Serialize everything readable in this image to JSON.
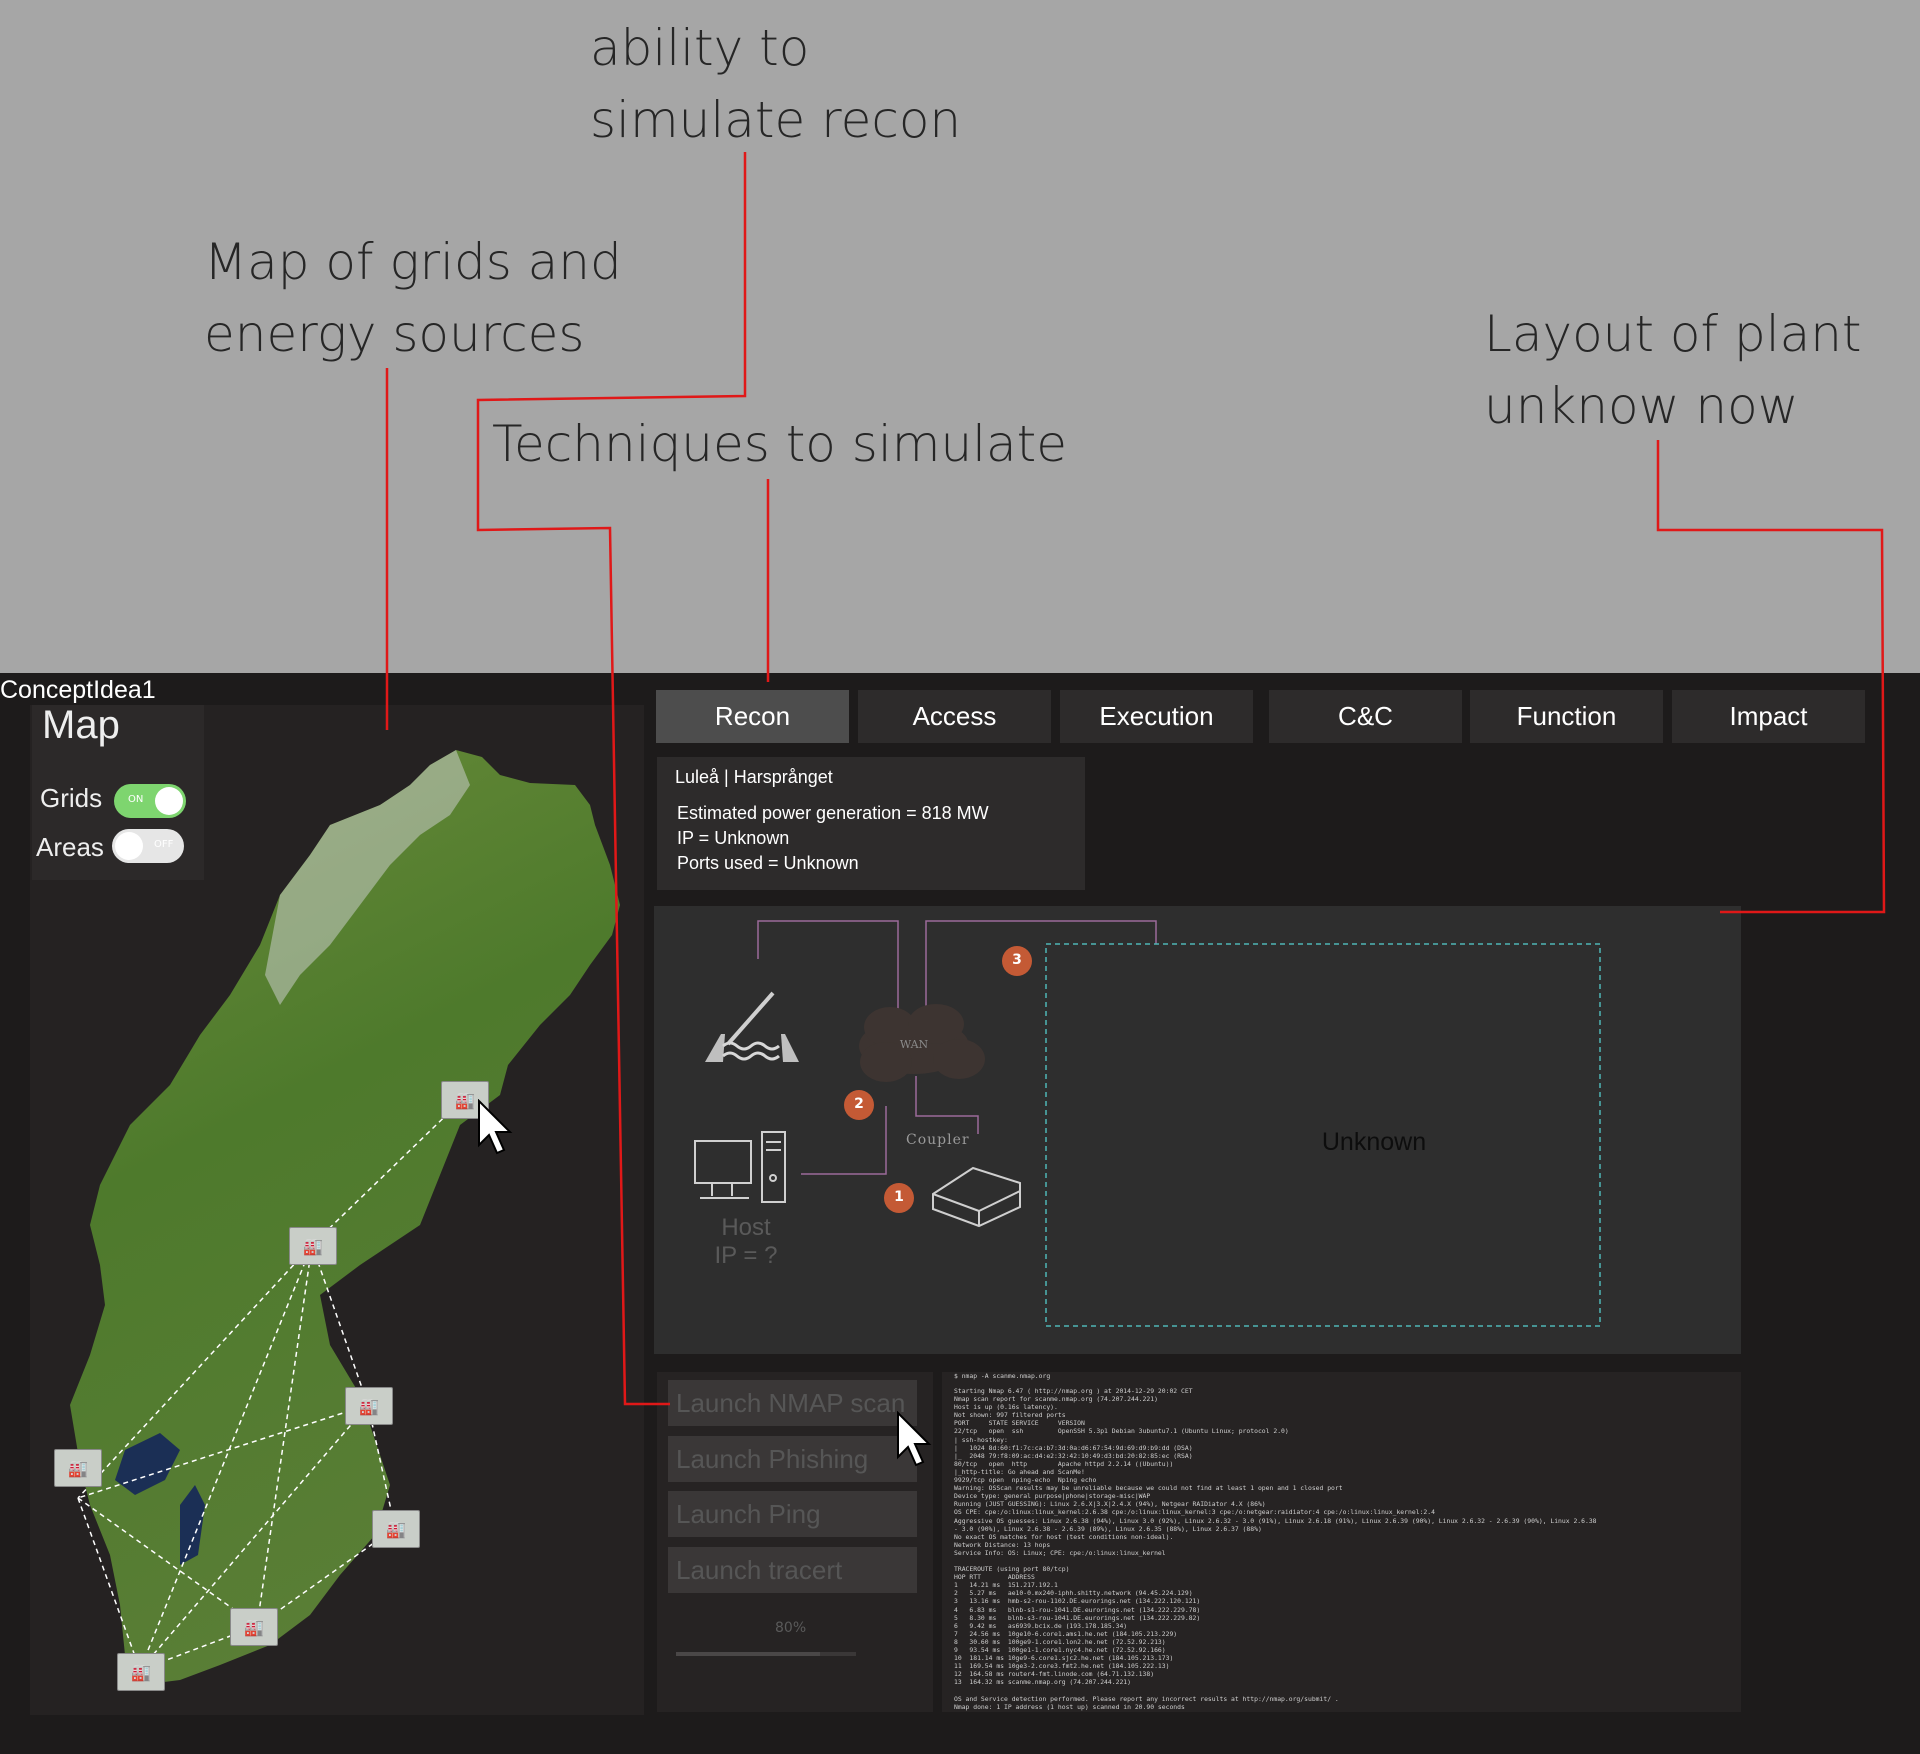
{
  "annotations": {
    "recon": [
      "ability to",
      "simulate recon"
    ],
    "map": [
      "Map of grids and",
      "energy sources"
    ],
    "techniques": "Techniques to simulate",
    "layout": [
      "Layout of plant",
      "unknow now"
    ]
  },
  "app": {
    "title": "ConceptIdea1"
  },
  "map_panel": {
    "title": "Map",
    "toggles": [
      {
        "label": "Grids",
        "state": "ON",
        "on": true
      },
      {
        "label": "Areas",
        "state": "OFF",
        "on": false
      }
    ],
    "plant_icon": "factory-icon"
  },
  "tabs": [
    "Recon",
    "Access",
    "Execution",
    "C&C",
    "Function",
    "Impact"
  ],
  "active_tab": "Recon",
  "info": {
    "location": "Luleå | Harsprånget",
    "power": "Estimated power generation = 818 MW",
    "ip": "IP = Unknown",
    "ports": "Ports used = Unknown"
  },
  "diagram": {
    "wan_label": "WAN",
    "coupler_label": "Coupler",
    "host_label": "Host",
    "host_ip": "IP = ?",
    "unknown_label": "Unknown",
    "steps": [
      "1",
      "2",
      "3"
    ],
    "step_color": "#c45a35",
    "dashed_color": "#4fb6b6"
  },
  "actions": {
    "buttons": [
      "Launch NMAP scan",
      "Launch Phishing",
      "Launch Ping",
      "Launch tracert"
    ],
    "progress_label": "80%",
    "progress": 0.8
  },
  "console": {
    "command": "$ nmap -A scanme.nmap.org",
    "lines": [
      "Starting Nmap 6.47 ( http://nmap.org ) at 2014-12-29 20:02 CET",
      "Nmap scan report for scanme.nmap.org (74.207.244.221)",
      "Host is up (0.16s latency).",
      "Not shown: 997 filtered ports",
      "PORT     STATE SERVICE     VERSION",
      "22/tcp   open  ssh         OpenSSH 5.3p1 Debian 3ubuntu7.1 (Ubuntu Linux; protocol 2.0)",
      "| ssh-hostkey:",
      "|   1024 8d:60:f1:7c:ca:b7:3d:0a:d6:67:54:9d:69:d9:b9:dd (DSA)",
      "|_  2048 79:f8:09:ac:d4:e2:32:42:10:49:d3:bd:20:82:85:ec (RSA)",
      "80/tcp   open  http        Apache httpd 2.2.14 ((Ubuntu))",
      "|_http-title: Go ahead and ScanMe!",
      "9929/tcp open  nping-echo  Nping echo",
      "Warning: OSScan results may be unreliable because we could not find at least 1 open and 1 closed port",
      "Device type: general purpose|phone|storage-misc|WAP",
      "Running (JUST GUESSING): Linux 2.6.X|3.X|2.4.X (94%), Netgear RAIDiator 4.X (86%)",
      "OS CPE: cpe:/o:linux:linux_kernel:2.6.38 cpe:/o:linux:linux_kernel:3 cpe:/o:netgear:raidiator:4 cpe:/o:linux:linux_kernel:2.4",
      "Aggressive OS guesses: Linux 2.6.38 (94%), Linux 3.0 (92%), Linux 2.6.32 - 3.0 (91%), Linux 2.6.18 (91%), Linux 2.6.39 (90%), Linux 2.6.32 - 2.6.39 (90%), Linux 2.6.38",
      "- 3.0 (90%), Linux 2.6.38 - 2.6.39 (89%), Linux 2.6.35 (88%), Linux 2.6.37 (88%)",
      "No exact OS matches for host (test conditions non-ideal).",
      "Network Distance: 13 hops",
      "Service Info: OS: Linux; CPE: cpe:/o:linux:linux_kernel",
      "",
      "TRACEROUTE (using port 80/tcp)",
      "HOP RTT       ADDRESS",
      "1   14.21 ms  151.217.192.1",
      "2   5.27 ms   ae10-0.mx240-iphh.shitty.network (94.45.224.129)",
      "3   13.16 ms  hmb-s2-rou-1102.DE.eurorings.net (134.222.120.121)",
      "4   6.83 ms   blnb-s1-rou-1041.DE.eurorings.net (134.222.229.78)",
      "5   8.30 ms   blnb-s3-rou-1041.DE.eurorings.net (134.222.229.82)",
      "6   9.42 ms   as6939.bcix.de (193.178.185.34)",
      "7   24.56 ms  10ge10-6.core1.ams1.he.net (184.105.213.229)",
      "8   30.60 ms  100ge9-1.core1.lon2.he.net (72.52.92.213)",
      "9   93.54 ms  100ge1-1.core1.nyc4.he.net (72.52.92.166)",
      "10  181.14 ms 10ge9-6.core1.sjc2.he.net (184.105.213.173)",
      "11  169.54 ms 10ge3-2.core3.fmt2.he.net (184.105.222.13)",
      "12  164.58 ms router4-fmt.linode.com (64.71.132.138)",
      "13  164.32 ms scanme.nmap.org (74.207.244.221)",
      "",
      "OS and Service detection performed. Please report any incorrect results at http://nmap.org/submit/ .",
      "Nmap done: 1 IP address (1 host up) scanned in 20.90 seconds"
    ]
  },
  "colors": {
    "annotation_line": "#e01818",
    "toggle_on": "#7ed56f",
    "toggle_off": "#e6e6e6"
  }
}
